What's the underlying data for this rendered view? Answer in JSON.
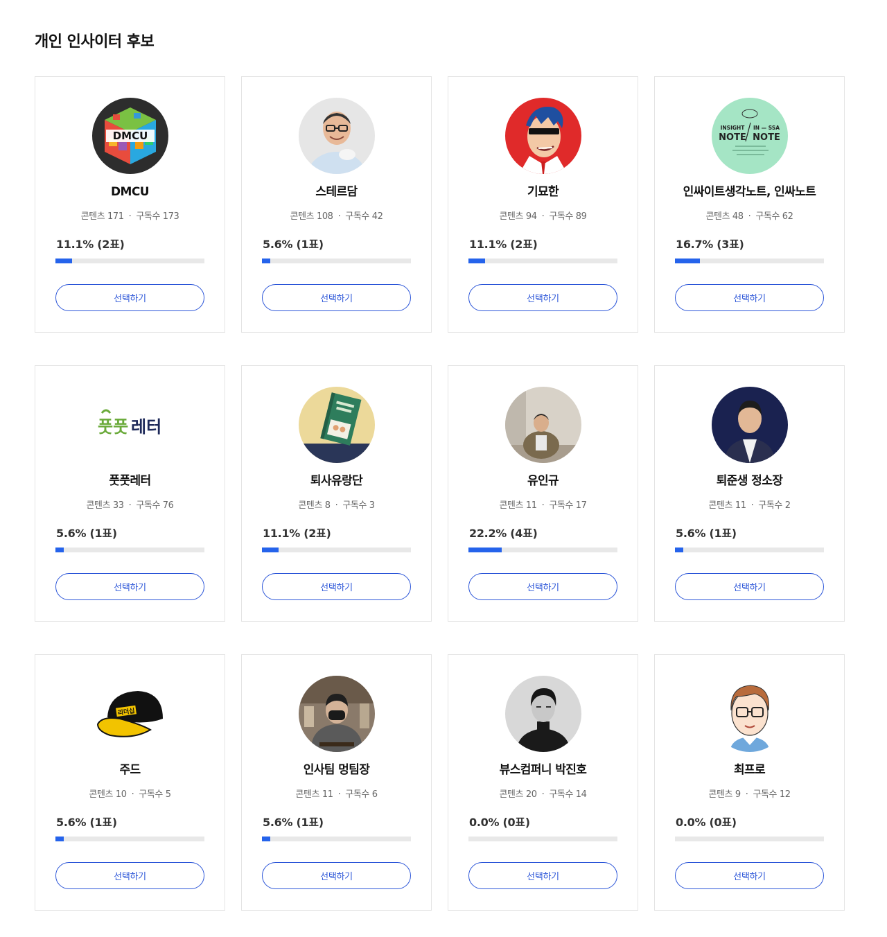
{
  "page_title": "개인 인사이터 후보",
  "brand_color": "#2563eb",
  "candidates": [
    {
      "name": "DMCU",
      "contents": "콘텐츠 171",
      "subscribers": "구독수 173",
      "vote_text": "11.1% (2표)",
      "percent": 11.1,
      "button": "선택하기",
      "avatar_icon": "dmcu-cube-logo-icon"
    },
    {
      "name": "스테르담",
      "contents": "콘텐츠 108",
      "subscribers": "구독수 42",
      "vote_text": "5.6% (1표)",
      "percent": 5.6,
      "button": "선택하기",
      "avatar_icon": "man-with-glasses-photo-icon"
    },
    {
      "name": "기묘한",
      "contents": "콘텐츠 94",
      "subscribers": "구독수 89",
      "vote_text": "11.1% (2표)",
      "percent": 11.1,
      "button": "선택하기",
      "avatar_icon": "comic-man-sunglasses-icon"
    },
    {
      "name": "인싸이트생각노트, 인싸노트",
      "contents": "콘텐츠 48",
      "subscribers": "구독수 62",
      "vote_text": "16.7% (3표)",
      "percent": 16.7,
      "button": "선택하기",
      "avatar_icon": "insight-note-logo-icon",
      "logo_text": {
        "left_top": "INSIGHT",
        "left_bottom": "NOTE",
        "right_top": "IN — SSA",
        "right_bottom": "NOTE"
      }
    },
    {
      "name": "풋풋레터",
      "contents": "콘텐츠 33",
      "subscribers": "구독수 76",
      "vote_text": "5.6% (1표)",
      "percent": 5.6,
      "button": "선택하기",
      "avatar_icon": "putput-letter-logo-icon",
      "logo_text": {
        "green": "풋풋",
        "navy": "레터"
      }
    },
    {
      "name": "퇴사유랑단",
      "contents": "콘텐츠 8",
      "subscribers": "구독수 3",
      "vote_text": "11.1% (2표)",
      "percent": 11.1,
      "button": "선택하기",
      "avatar_icon": "green-book-cover-icon"
    },
    {
      "name": "유인규",
      "contents": "콘텐츠 11",
      "subscribers": "구독수 17",
      "vote_text": "22.2% (4표)",
      "percent": 22.2,
      "button": "선택하기",
      "avatar_icon": "seated-man-photo-icon"
    },
    {
      "name": "퇴준생 정소장",
      "contents": "콘텐츠 11",
      "subscribers": "구독수 2",
      "vote_text": "5.6% (1표)",
      "percent": 5.6,
      "button": "선택하기",
      "avatar_icon": "man-navy-background-photo-icon"
    },
    {
      "name": "주드",
      "contents": "콘텐츠 10",
      "subscribers": "구독수 5",
      "vote_text": "5.6% (1표)",
      "percent": 5.6,
      "button": "선택하기",
      "avatar_icon": "black-yellow-cap-icon",
      "logo_text": {
        "cap": "리더십"
      }
    },
    {
      "name": "인사팀 멍팀장",
      "contents": "콘텐츠 11",
      "subscribers": "구독수 6",
      "vote_text": "5.6% (1표)",
      "percent": 5.6,
      "button": "선택하기",
      "avatar_icon": "masked-person-cafe-photo-icon"
    },
    {
      "name": "뷰스컴퍼니 박진호",
      "contents": "콘텐츠 20",
      "subscribers": "구독수 14",
      "vote_text": "0.0% (0표)",
      "percent": 0,
      "button": "선택하기",
      "avatar_icon": "black-white-portrait-icon"
    },
    {
      "name": "최프로",
      "contents": "콘텐츠 9",
      "subscribers": "구독수 12",
      "vote_text": "0.0% (0표)",
      "percent": 0,
      "button": "선택하기",
      "avatar_icon": "cartoon-man-glasses-icon"
    }
  ]
}
